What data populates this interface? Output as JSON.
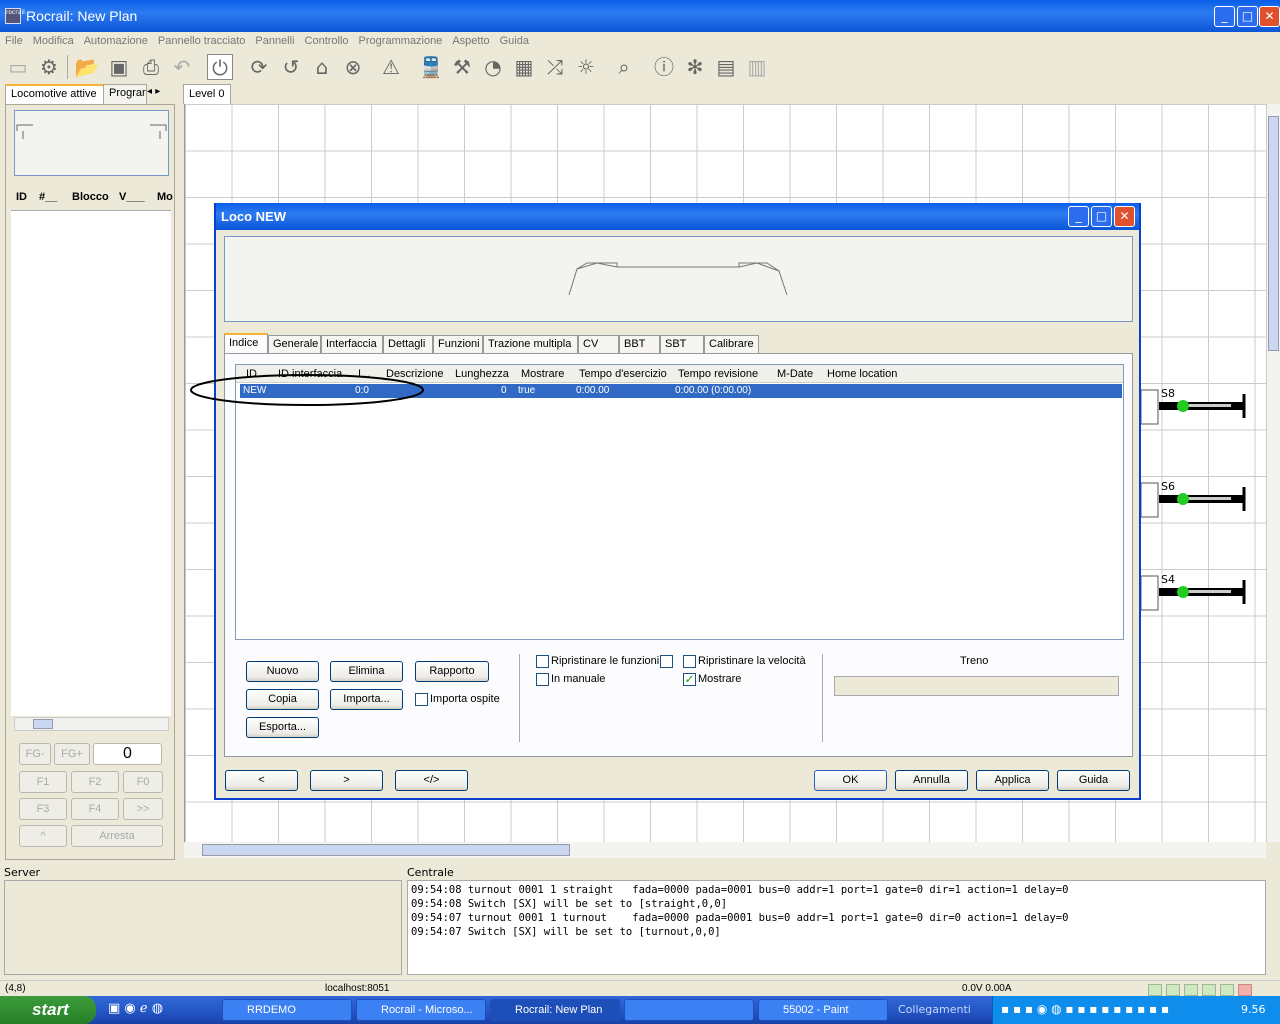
{
  "window": {
    "title": "Rocrail: New Plan",
    "icon_text": "Rocrail"
  },
  "menu": [
    "File",
    "Modifica",
    "Automazione",
    "Pannello tracciato",
    "Pannelli",
    "Controllo",
    "Programmazione",
    "Aspetto",
    "Guida"
  ],
  "toolbar_icons": [
    "server-icon",
    "settings-icon",
    "open-icon",
    "save-icon",
    "print-icon",
    "undo-icon",
    "power-icon",
    "sync-icon",
    "refresh-icon",
    "home-icon",
    "stop-icon",
    "warning-icon",
    "train-icon",
    "wrench-icon",
    "speedometer-icon",
    "grid-icon",
    "shuffle-icon",
    "light-icon",
    "search-icon",
    "info-icon",
    "bug-icon",
    "document-icon",
    "pages-icon"
  ],
  "left_panel": {
    "tabs": [
      "Locomotive attive",
      "Programmazione"
    ],
    "columns": [
      "ID",
      "#__",
      "Blocco",
      "V___",
      "Mo"
    ],
    "fn_buttons": [
      "FG-",
      "FG+",
      "0",
      "F1",
      "F2",
      "F0",
      "F3",
      "F4",
      ">>",
      "^",
      "Arresta"
    ]
  },
  "plan": {
    "tab": "Level 0",
    "signals": [
      "S8",
      "S6",
      "S4"
    ]
  },
  "dialog": {
    "title": "Loco NEW",
    "tabs": [
      "Indice",
      "Generale",
      "Interfaccia",
      "Dettagli",
      "Funzioni",
      "Trazione multipla",
      "CV",
      "BBT",
      "SBT",
      "Calibrare"
    ],
    "table": {
      "columns": [
        "ID",
        "ID interfaccia",
        "I...",
        "Descrizione",
        "Lunghezza",
        "Mostrare",
        "Tempo d'esercizio",
        "Tempo revisione",
        "M-Date",
        "Home location"
      ],
      "rows": [
        {
          "id": "NEW",
          "iid": "",
          "i": "0:0",
          "desc": "",
          "len": "0",
          "show": "true",
          "tempo": "0:00.00",
          "rev": "0:00.00 (0:00.00)",
          "mdate": "",
          "home": ""
        }
      ]
    },
    "buttons": {
      "nuovo": "Nuovo",
      "elimina": "Elimina",
      "rapporto": "Rapporto",
      "copia": "Copia",
      "importa": "Importa...",
      "esporta": "Esporta...",
      "prev": "<",
      "next": ">",
      "xml": "</>",
      "ok": "OK",
      "annulla": "Annulla",
      "applica": "Applica",
      "guida": "Guida"
    },
    "checkboxes": {
      "importa_ospite": {
        "label": "Importa ospite",
        "checked": false
      },
      "ripristinare_funzioni": {
        "label": "Ripristinare le funzioni",
        "checked": false
      },
      "in_manuale": {
        "label": "In manuale",
        "checked": false
      },
      "ripristinare_velocita": {
        "label": "Ripristinare la velocità",
        "checked": false
      },
      "mostrare": {
        "label": "Mostrare",
        "checked": true
      }
    },
    "treno_label": "Treno"
  },
  "server_label": "Server",
  "centrale_label": "Centrale",
  "log": [
    "09:54:08 turnout 0001 1 straight   fada=0000 pada=0001 bus=0 addr=1 port=1 gate=0 dir=1 action=1 delay=0",
    "09:54:08 Switch [SX] will be set to [straight,0,0]",
    "09:54:07 turnout 0001 1 turnout    fada=0000 pada=0001 bus=0 addr=1 port=1 gate=0 dir=0 action=1 delay=0",
    "09:54:07 Switch [SX] will be set to [turnout,0,0]"
  ],
  "status": {
    "coords": "(4,8)",
    "host": "localhost:8051",
    "power": "0.0V 0.00A"
  },
  "taskbar": {
    "start": "start",
    "tasks": [
      "RRDEMO",
      "Rocrail - Microso...",
      "Rocrail: New Plan",
      "",
      "55002 - Paint"
    ],
    "links": "Collegamenti",
    "clock": "9.56"
  }
}
